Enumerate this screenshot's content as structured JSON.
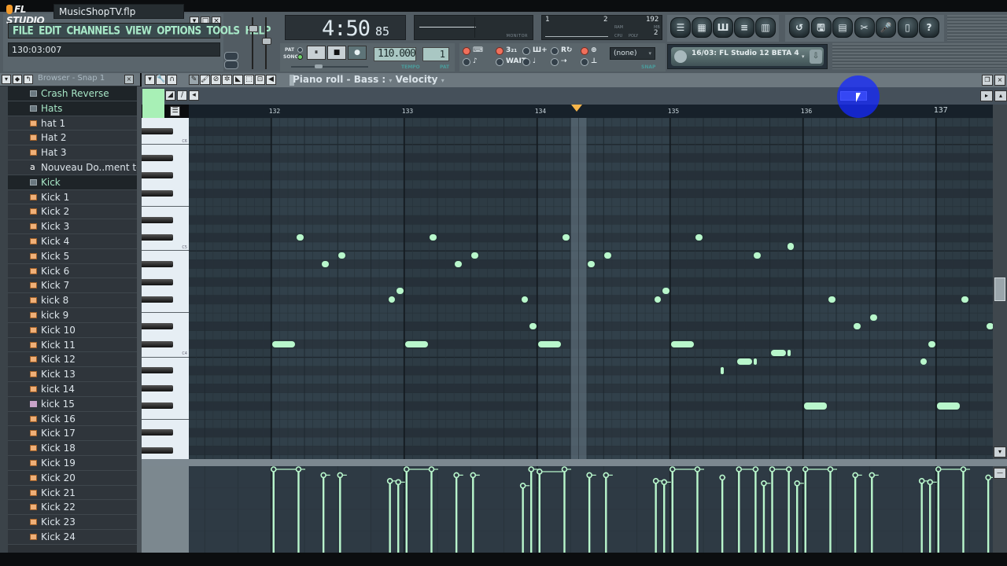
{
  "app": {
    "logo": "FL STUDIO",
    "project_title": "MusicShopTV.flp",
    "window_controls": [
      "▾",
      "□",
      "×"
    ],
    "menu": [
      "FILE",
      "EDIT",
      "CHANNELS",
      "VIEW",
      "OPTIONS",
      "TOOLS",
      "HELP"
    ],
    "song_position": "130:03:007"
  },
  "time_display": {
    "main": "4:50",
    "sub": "85"
  },
  "monitor": {
    "label": "MONITOR"
  },
  "cpu_panel": {
    "ram_label": "RAM",
    "cpu_label": "CPU",
    "poly_label": "POLY",
    "mb_label": "MB",
    "left_value": "1",
    "right_value": "2",
    "ram_value": "192",
    "poly_value": "2"
  },
  "transport": {
    "pat_label": "PAT",
    "song_label": "SONG",
    "mode": "SONG",
    "pause_icon": "⏸",
    "stop_icon": "■",
    "record_icon": "●",
    "tempo": "110.000",
    "tempo_label": "TEMPO",
    "pattern": "1",
    "pattern_label": "PAT"
  },
  "recording": {
    "toggles": [
      {
        "name": "typing-keyboard",
        "glyph": "⌨",
        "on": true
      },
      {
        "name": "metronome-count",
        "glyph": "3₂₁",
        "on": true
      },
      {
        "name": "step-edit",
        "glyph": "Ш+",
        "on": false
      },
      {
        "name": "recording-loop",
        "glyph": "R↻",
        "on": false
      },
      {
        "name": "multilink",
        "glyph": "⊕",
        "on": true
      },
      {
        "name": "metronome",
        "glyph": "♪",
        "on": false
      },
      {
        "name": "wait-for-input",
        "glyph": "WAIT",
        "on": false
      },
      {
        "name": "blend-notes",
        "glyph": "♩",
        "on": false
      },
      {
        "name": "scroll-follow",
        "glyph": "⇢",
        "on": false
      },
      {
        "name": "punch",
        "glyph": "⊥",
        "on": false
      }
    ],
    "snap_value": "(none)",
    "snap_label": "SNAP"
  },
  "window_buttons": [
    {
      "name": "playlist",
      "glyph": "☰"
    },
    {
      "name": "step-sequencer",
      "glyph": "▦"
    },
    {
      "name": "piano-roll",
      "glyph": "Ш"
    },
    {
      "name": "browser",
      "glyph": "≡"
    },
    {
      "name": "mixer",
      "glyph": "▥"
    }
  ],
  "tool_buttons": [
    {
      "name": "undo",
      "glyph": "↺"
    },
    {
      "name": "save-new",
      "glyph": "🖫"
    },
    {
      "name": "render",
      "glyph": "▤"
    },
    {
      "name": "edison",
      "glyph": "✂"
    },
    {
      "name": "record-audio",
      "glyph": "🎤"
    },
    {
      "name": "project-info",
      "glyph": "▯"
    },
    {
      "name": "help",
      "glyph": "?"
    }
  ],
  "news": {
    "text": "16/03: FL Studio 12 BETA 4"
  },
  "browser": {
    "title": "Browser - Snap 1",
    "items": [
      {
        "label": "Crash Reverse",
        "type": "folder"
      },
      {
        "label": "Hats",
        "type": "folder"
      },
      {
        "label": "hat 1",
        "type": "audio"
      },
      {
        "label": "Hat 2",
        "type": "audio"
      },
      {
        "label": "Hat 3",
        "type": "audio"
      },
      {
        "label": "Nouveau Do..ment texte",
        "type": "text"
      },
      {
        "label": "Kick",
        "type": "folder"
      },
      {
        "label": "Kick 1",
        "type": "audio"
      },
      {
        "label": "Kick 2",
        "type": "audio"
      },
      {
        "label": "Kick 3",
        "type": "audio"
      },
      {
        "label": "Kick 4",
        "type": "audio"
      },
      {
        "label": "Kick 5",
        "type": "audio"
      },
      {
        "label": "Kick 6",
        "type": "audio"
      },
      {
        "label": "Kick 7",
        "type": "audio"
      },
      {
        "label": "kick 8",
        "type": "audio"
      },
      {
        "label": "kick 9",
        "type": "audio"
      },
      {
        "label": "Kick 10",
        "type": "audio"
      },
      {
        "label": "Kick 11",
        "type": "audio"
      },
      {
        "label": "Kick 12",
        "type": "audio"
      },
      {
        "label": "Kick 13",
        "type": "audio"
      },
      {
        "label": "kick 14",
        "type": "audio"
      },
      {
        "label": "kick 15",
        "type": "plugin"
      },
      {
        "label": "Kick 16",
        "type": "audio"
      },
      {
        "label": "Kick 17",
        "type": "audio"
      },
      {
        "label": "Kick 18",
        "type": "audio"
      },
      {
        "label": "Kick 19",
        "type": "audio"
      },
      {
        "label": "Kick 20",
        "type": "audio"
      },
      {
        "label": "Kick 21",
        "type": "audio"
      },
      {
        "label": "Kick 22",
        "type": "audio"
      },
      {
        "label": "Kick 23",
        "type": "audio"
      },
      {
        "label": "Kick 24",
        "type": "audio"
      }
    ]
  },
  "piano_roll": {
    "title": "Piano roll - Bass :",
    "target": "Velocity",
    "note_color": "#b9f7cc",
    "bars": [
      "132",
      "133",
      "134",
      "135",
      "136",
      "137"
    ],
    "octave_labels": [
      "C6",
      "C5",
      "C4"
    ],
    "playhead_bar": 134.3,
    "view": {
      "first_bar": 131.38,
      "steps_per_bar": 16,
      "top_row_pitch": 86
    },
    "notes": [
      {
        "bar": 132,
        "step": 0,
        "len": 3,
        "pitch": 61
      },
      {
        "bar": 132,
        "step": 3,
        "len": 1,
        "pitch": 73
      },
      {
        "bar": 132,
        "step": 6,
        "len": 1,
        "pitch": 70
      },
      {
        "bar": 132,
        "step": 8,
        "len": 1,
        "pitch": 71
      },
      {
        "bar": 132,
        "step": 14,
        "len": 1,
        "pitch": 66
      },
      {
        "bar": 132,
        "step": 15,
        "len": 1,
        "pitch": 67
      },
      {
        "bar": 133,
        "step": 0,
        "len": 3,
        "pitch": 61
      },
      {
        "bar": 133,
        "step": 3,
        "len": 1,
        "pitch": 73
      },
      {
        "bar": 133,
        "step": 6,
        "len": 1,
        "pitch": 70
      },
      {
        "bar": 133,
        "step": 8,
        "len": 1,
        "pitch": 71
      },
      {
        "bar": 133,
        "step": 14,
        "len": 1,
        "pitch": 66
      },
      {
        "bar": 133,
        "step": 15,
        "len": 1,
        "pitch": 63
      },
      {
        "bar": 134,
        "step": 0,
        "len": 3,
        "pitch": 61
      },
      {
        "bar": 134,
        "step": 3,
        "len": 1,
        "pitch": 73
      },
      {
        "bar": 134,
        "step": 6,
        "len": 1,
        "pitch": 70
      },
      {
        "bar": 134,
        "step": 8,
        "len": 1,
        "pitch": 71
      },
      {
        "bar": 134,
        "step": 14,
        "len": 1,
        "pitch": 66
      },
      {
        "bar": 134,
        "step": 15,
        "len": 1,
        "pitch": 67
      },
      {
        "bar": 135,
        "step": 0,
        "len": 3,
        "pitch": 61
      },
      {
        "bar": 135,
        "step": 3,
        "len": 1,
        "pitch": 73
      },
      {
        "bar": 135,
        "step": 6,
        "len": 0.5,
        "pitch": 58
      },
      {
        "bar": 135,
        "step": 8,
        "len": 2,
        "pitch": 59
      },
      {
        "bar": 135,
        "step": 10,
        "len": 0.5,
        "pitch": 59
      },
      {
        "bar": 135,
        "step": 10,
        "len": 1,
        "pitch": 71
      },
      {
        "bar": 135,
        "step": 12,
        "len": 2,
        "pitch": 60
      },
      {
        "bar": 135,
        "step": 14,
        "len": 1,
        "pitch": 72
      },
      {
        "bar": 135,
        "step": 14,
        "len": 0.5,
        "pitch": 60
      },
      {
        "bar": 136,
        "step": 0,
        "len": 3,
        "pitch": 54
      },
      {
        "bar": 136,
        "step": 3,
        "len": 1,
        "pitch": 66
      },
      {
        "bar": 136,
        "step": 6,
        "len": 1,
        "pitch": 63
      },
      {
        "bar": 136,
        "step": 8,
        "len": 1,
        "pitch": 64
      },
      {
        "bar": 136,
        "step": 14,
        "len": 1,
        "pitch": 59
      },
      {
        "bar": 136,
        "step": 15,
        "len": 1,
        "pitch": 61
      },
      {
        "bar": 137,
        "step": 0,
        "len": 3,
        "pitch": 54
      },
      {
        "bar": 137,
        "step": 3,
        "len": 1,
        "pitch": 66
      },
      {
        "bar": 137,
        "step": 6,
        "len": 1,
        "pitch": 63
      }
    ],
    "velocity_events": [
      {
        "bar": 132,
        "step": 0,
        "vel": 1.0,
        "len": 3
      },
      {
        "bar": 132,
        "step": 3,
        "vel": 1.0,
        "len": 1
      },
      {
        "bar": 132,
        "step": 6,
        "vel": 0.95,
        "len": 1
      },
      {
        "bar": 132,
        "step": 8,
        "vel": 0.95,
        "len": 1
      },
      {
        "bar": 132,
        "step": 14,
        "vel": 0.9,
        "len": 1
      },
      {
        "bar": 132,
        "step": 15,
        "vel": 0.89,
        "len": 1
      },
      {
        "bar": 133,
        "step": 0,
        "vel": 1.0,
        "len": 3
      },
      {
        "bar": 133,
        "step": 3,
        "vel": 1.0,
        "len": 1
      },
      {
        "bar": 133,
        "step": 6,
        "vel": 0.95,
        "len": 1
      },
      {
        "bar": 133,
        "step": 8,
        "vel": 0.95,
        "len": 1
      },
      {
        "bar": 133,
        "step": 14,
        "vel": 0.86,
        "len": 1
      },
      {
        "bar": 133,
        "step": 15,
        "vel": 1.0,
        "len": 1
      },
      {
        "bar": 134,
        "step": 0,
        "vel": 0.98,
        "len": 3
      },
      {
        "bar": 134,
        "step": 3,
        "vel": 1.0,
        "len": 1
      },
      {
        "bar": 134,
        "step": 6,
        "vel": 0.95,
        "len": 1
      },
      {
        "bar": 134,
        "step": 8,
        "vel": 0.95,
        "len": 1
      },
      {
        "bar": 134,
        "step": 14,
        "vel": 0.9,
        "len": 1
      },
      {
        "bar": 134,
        "step": 15,
        "vel": 0.89,
        "len": 1
      },
      {
        "bar": 135,
        "step": 0,
        "vel": 1.0,
        "len": 3
      },
      {
        "bar": 135,
        "step": 3,
        "vel": 1.0,
        "len": 1
      },
      {
        "bar": 135,
        "step": 6,
        "vel": 0.93,
        "len": 0.5
      },
      {
        "bar": 135,
        "step": 8,
        "vel": 1.0,
        "len": 2
      },
      {
        "bar": 135,
        "step": 10,
        "vel": 1.0,
        "len": 0.5
      },
      {
        "bar": 135,
        "step": 11,
        "vel": 0.88,
        "len": 1
      },
      {
        "bar": 135,
        "step": 12,
        "vel": 1.0,
        "len": 2
      },
      {
        "bar": 135,
        "step": 14,
        "vel": 1.0,
        "len": 0.5
      },
      {
        "bar": 135,
        "step": 15,
        "vel": 0.88,
        "len": 1
      },
      {
        "bar": 136,
        "step": 0,
        "vel": 1.0,
        "len": 3
      },
      {
        "bar": 136,
        "step": 3,
        "vel": 1.0,
        "len": 1
      },
      {
        "bar": 136,
        "step": 6,
        "vel": 0.95,
        "len": 1
      },
      {
        "bar": 136,
        "step": 8,
        "vel": 0.95,
        "len": 1
      },
      {
        "bar": 136,
        "step": 14,
        "vel": 0.9,
        "len": 1
      },
      {
        "bar": 136,
        "step": 15,
        "vel": 0.89,
        "len": 1
      },
      {
        "bar": 137,
        "step": 0,
        "vel": 1.0,
        "len": 3
      },
      {
        "bar": 137,
        "step": 3,
        "vel": 1.0,
        "len": 1
      },
      {
        "bar": 137,
        "step": 6,
        "vel": 0.93,
        "len": 1
      }
    ]
  }
}
